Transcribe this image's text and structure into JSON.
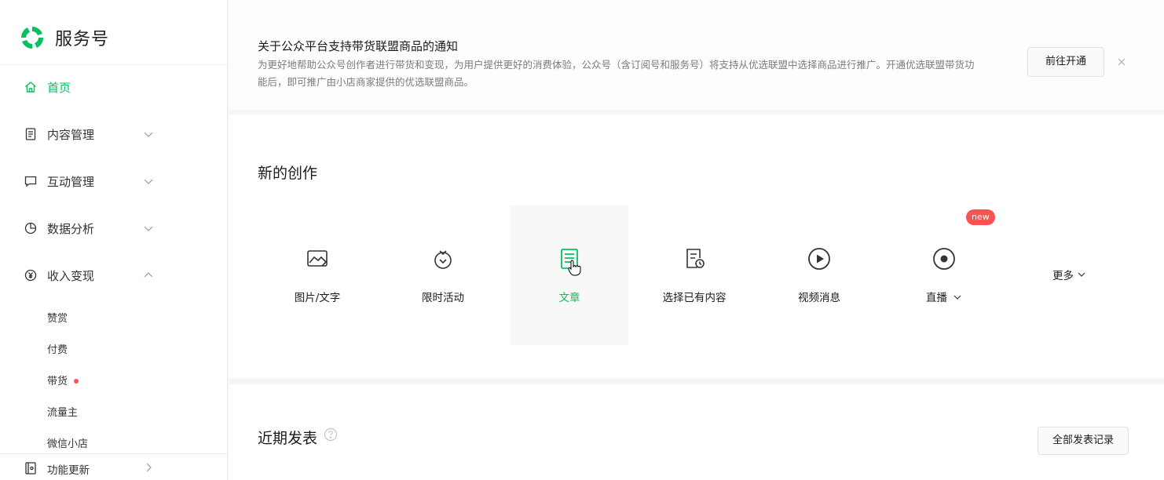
{
  "sidebar": {
    "brand": "服务号",
    "nav": [
      {
        "key": "home",
        "label": "首页",
        "icon": "home-icon",
        "active": true
      },
      {
        "key": "content",
        "label": "内容管理",
        "icon": "document-icon",
        "chevron": "down"
      },
      {
        "key": "interaction",
        "label": "互动管理",
        "icon": "chat-bubble-icon",
        "chevron": "down"
      },
      {
        "key": "analytics",
        "label": "数据分析",
        "icon": "pie-chart-icon",
        "chevron": "down"
      },
      {
        "key": "monetization",
        "label": "收入变现",
        "icon": "yuan-icon",
        "chevron": "up"
      }
    ],
    "sub_items": [
      "赞赏",
      "付费",
      "带货",
      "流量主",
      "微信小店"
    ],
    "feature_update": "功能更新"
  },
  "notice": {
    "title": "关于公众平台支持带货联盟商品的通知",
    "description": "为更好地帮助公众号创作者进行带货和变现，为用户提供更好的消费体验，公众号（含订阅号和服务号）将支持从优选联盟中选择商品进行推广。开通优选联盟带货功能后，即可推广由小店商家提供的优选联盟商品。",
    "button": "前往开通"
  },
  "create": {
    "title": "新的创作",
    "tools": [
      {
        "label": "图片/文字",
        "icon": "image-text-icon"
      },
      {
        "label": "限时活动",
        "icon": "timer-activity-icon"
      },
      {
        "label": "文章",
        "icon": "article-icon",
        "active": true
      },
      {
        "label": "选择已有内容",
        "icon": "existing-content-icon"
      },
      {
        "label": "视频消息",
        "icon": "video-play-icon"
      },
      {
        "label": "直播",
        "icon": "live-icon"
      }
    ],
    "new_badge": "new",
    "more": "更多"
  },
  "recent": {
    "title": "近期发表",
    "button": "全部发表记录"
  },
  "colors": {
    "accent": "#07c160",
    "badge": "#fa5151"
  }
}
